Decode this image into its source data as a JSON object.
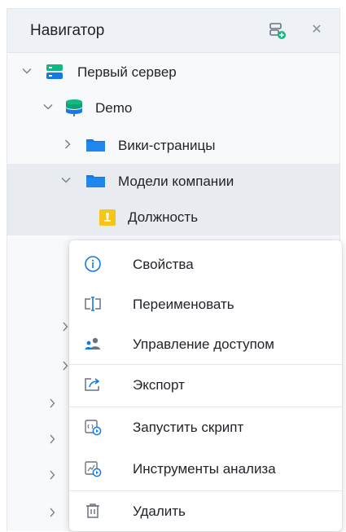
{
  "navigator": {
    "title": "Навигатор",
    "add_icon": "add-server-icon",
    "close_icon": "close-icon",
    "close_glyph": "✕"
  },
  "tree": {
    "server": {
      "label": "Первый сервер",
      "icon": "server-icon",
      "color": "#10b981"
    },
    "database": {
      "label": "Demo",
      "icon": "database-icon",
      "color": "#10b981"
    },
    "wiki": {
      "label": "Вики-страницы",
      "icon": "folder-icon",
      "color": "#1479e6"
    },
    "models": {
      "label": "Модели компании",
      "icon": "folder-icon",
      "color": "#1479e6"
    },
    "position": {
      "label": "Должность",
      "icon": "model-icon",
      "color": "#f5c518"
    }
  },
  "context_menu": {
    "items": [
      {
        "label": "Свойства",
        "icon": "info-icon"
      },
      {
        "label": "Переименовать",
        "icon": "rename-icon"
      },
      {
        "label": "Управление доступом",
        "icon": "access-icon"
      },
      {
        "label": "Экспорт",
        "icon": "export-icon"
      },
      {
        "label": "Запустить скрипт",
        "icon": "run-script-icon"
      },
      {
        "label": "Инструменты анализа",
        "icon": "analysis-tools-icon"
      },
      {
        "label": "Удалить",
        "icon": "trash-icon"
      }
    ]
  },
  "colors": {
    "accent_green": "#10b981",
    "folder_blue": "#1479e6",
    "model_yellow": "#f5c518",
    "selected_row": "#e8ecf1"
  }
}
